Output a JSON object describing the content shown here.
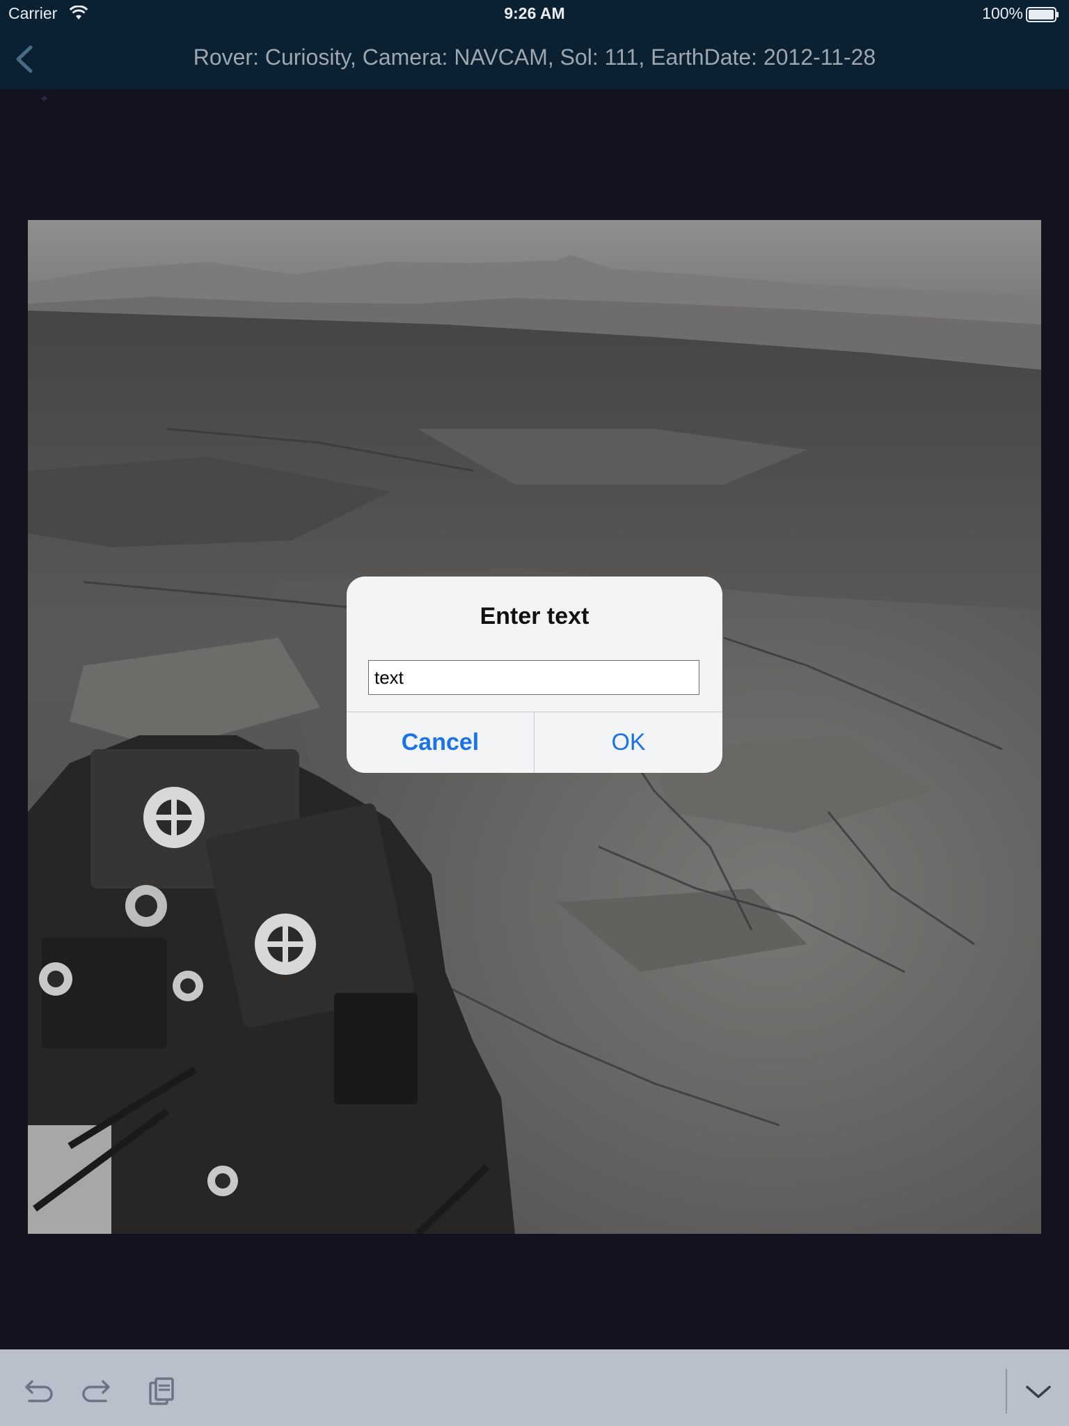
{
  "status_bar": {
    "carrier": "Carrier",
    "time": "9:26 AM",
    "battery": "100%"
  },
  "nav": {
    "title": "Rover: Curiosity, Camera: NAVCAM, Sol: 111, EarthDate: 2012-11-28",
    "back_icon": "chevron-left-icon"
  },
  "dialog": {
    "title": "Enter text",
    "input_value": "text",
    "cancel_label": "Cancel",
    "ok_label": "OK"
  },
  "keyboard_toolbar": {
    "undo_icon": "undo-icon",
    "redo_icon": "redo-icon",
    "paste_icon": "paste-icon",
    "dismiss_icon": "chevron-down-icon"
  },
  "colors": {
    "nav_background": "#0b2132",
    "page_background": "#13121f",
    "accent": "#1a73e8",
    "toolbar_background": "#b9c0cb"
  }
}
